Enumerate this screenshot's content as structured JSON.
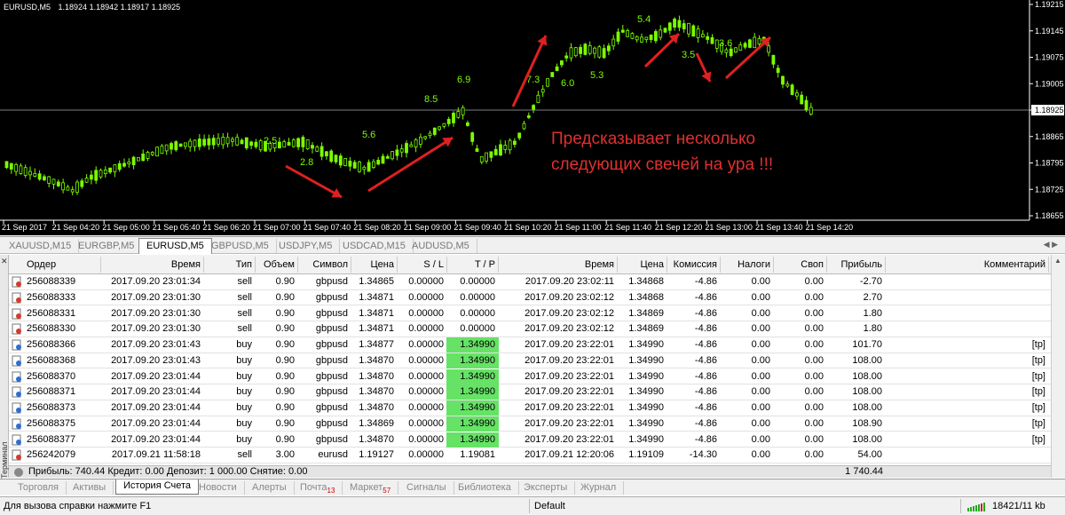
{
  "chart": {
    "symbol": "EURUSD,M5",
    "ohlc": "1.18924 1.18942 1.18917 1.18925",
    "price_levels": [
      "1.19215",
      "1.19145",
      "1.19075",
      "1.19005",
      "1.18925",
      "1.18865",
      "1.18795",
      "1.18725",
      "1.18655"
    ],
    "current_price": "1.18925",
    "time_labels": [
      "21 Sep 2017",
      "21 Sep 04:20",
      "21 Sep 05:00",
      "21 Sep 05:40",
      "21 Sep 06:20",
      "21 Sep 07:00",
      "21 Sep 07:40",
      "21 Sep 08:20",
      "21 Sep 09:00",
      "21 Sep 09:40",
      "21 Sep 10:20",
      "21 Sep 11:00",
      "21 Sep 11:40",
      "21 Sep 12:20",
      "21 Sep 13:00",
      "21 Sep 13:40",
      "21 Sep 14:20"
    ],
    "annotation": [
      "Предсказывает несколько",
      "следующих свечей на ура !!!"
    ],
    "chart_labels": [
      "2.5",
      "2.8",
      "5.6",
      "8.5",
      "6.9",
      "7.3",
      "6.0",
      "5.3",
      "5.4",
      "3.5",
      "3.6"
    ],
    "colors": {
      "background": "#000000",
      "candle": "#7CFC00",
      "grid": "#ffffff",
      "annotation": "#e03030",
      "arrow": "#e02020"
    }
  },
  "chart_tabs": [
    "XAUUSD,M15",
    "EURGBP,M5",
    "EURUSD,M5",
    "GBPUSD,M5",
    "USDJPY,M5",
    "USDCAD,M15",
    "AUDUSD,M5"
  ],
  "chart_tabs_active": "EURUSD,M5",
  "table": {
    "headers": {
      "order": "Ордер",
      "open_time": "Время",
      "type": "Тип",
      "volume": "Объем",
      "symbol": "Символ",
      "price": "Цена",
      "sl": "S / L",
      "tp": "T / P",
      "close_time": "Время",
      "close_price": "Цена",
      "commission": "Комиссия",
      "taxes": "Налоги",
      "swap": "Своп",
      "profit": "Прибыль",
      "comment": "Комментарий"
    },
    "rows": [
      {
        "order": "256088339",
        "open_time": "2017.09.20 23:01:34",
        "type": "sell",
        "volume": "0.90",
        "symbol": "gbpusd",
        "price": "1.34865",
        "sl": "0.00000",
        "tp": "0.00000",
        "close_time": "2017.09.20 23:02:11",
        "close_price": "1.34868",
        "commission": "-4.86",
        "taxes": "0.00",
        "swap": "0.00",
        "profit": "-2.70",
        "comment": "",
        "tp_hit": false
      },
      {
        "order": "256088333",
        "open_time": "2017.09.20 23:01:30",
        "type": "sell",
        "volume": "0.90",
        "symbol": "gbpusd",
        "price": "1.34871",
        "sl": "0.00000",
        "tp": "0.00000",
        "close_time": "2017.09.20 23:02:12",
        "close_price": "1.34868",
        "commission": "-4.86",
        "taxes": "0.00",
        "swap": "0.00",
        "profit": "2.70",
        "comment": "",
        "tp_hit": false
      },
      {
        "order": "256088331",
        "open_time": "2017.09.20 23:01:30",
        "type": "sell",
        "volume": "0.90",
        "symbol": "gbpusd",
        "price": "1.34871",
        "sl": "0.00000",
        "tp": "0.00000",
        "close_time": "2017.09.20 23:02:12",
        "close_price": "1.34869",
        "commission": "-4.86",
        "taxes": "0.00",
        "swap": "0.00",
        "profit": "1.80",
        "comment": "",
        "tp_hit": false
      },
      {
        "order": "256088330",
        "open_time": "2017.09.20 23:01:30",
        "type": "sell",
        "volume": "0.90",
        "symbol": "gbpusd",
        "price": "1.34871",
        "sl": "0.00000",
        "tp": "0.00000",
        "close_time": "2017.09.20 23:02:12",
        "close_price": "1.34869",
        "commission": "-4.86",
        "taxes": "0.00",
        "swap": "0.00",
        "profit": "1.80",
        "comment": "",
        "tp_hit": false
      },
      {
        "order": "256088366",
        "open_time": "2017.09.20 23:01:43",
        "type": "buy",
        "volume": "0.90",
        "symbol": "gbpusd",
        "price": "1.34877",
        "sl": "0.00000",
        "tp": "1.34990",
        "close_time": "2017.09.20 23:22:01",
        "close_price": "1.34990",
        "commission": "-4.86",
        "taxes": "0.00",
        "swap": "0.00",
        "profit": "101.70",
        "comment": "[tp]",
        "tp_hit": true
      },
      {
        "order": "256088368",
        "open_time": "2017.09.20 23:01:43",
        "type": "buy",
        "volume": "0.90",
        "symbol": "gbpusd",
        "price": "1.34870",
        "sl": "0.00000",
        "tp": "1.34990",
        "close_time": "2017.09.20 23:22:01",
        "close_price": "1.34990",
        "commission": "-4.86",
        "taxes": "0.00",
        "swap": "0.00",
        "profit": "108.00",
        "comment": "[tp]",
        "tp_hit": true
      },
      {
        "order": "256088370",
        "open_time": "2017.09.20 23:01:44",
        "type": "buy",
        "volume": "0.90",
        "symbol": "gbpusd",
        "price": "1.34870",
        "sl": "0.00000",
        "tp": "1.34990",
        "close_time": "2017.09.20 23:22:01",
        "close_price": "1.34990",
        "commission": "-4.86",
        "taxes": "0.00",
        "swap": "0.00",
        "profit": "108.00",
        "comment": "[tp]",
        "tp_hit": true
      },
      {
        "order": "256088371",
        "open_time": "2017.09.20 23:01:44",
        "type": "buy",
        "volume": "0.90",
        "symbol": "gbpusd",
        "price": "1.34870",
        "sl": "0.00000",
        "tp": "1.34990",
        "close_time": "2017.09.20 23:22:01",
        "close_price": "1.34990",
        "commission": "-4.86",
        "taxes": "0.00",
        "swap": "0.00",
        "profit": "108.00",
        "comment": "[tp]",
        "tp_hit": true
      },
      {
        "order": "256088373",
        "open_time": "2017.09.20 23:01:44",
        "type": "buy",
        "volume": "0.90",
        "symbol": "gbpusd",
        "price": "1.34870",
        "sl": "0.00000",
        "tp": "1.34990",
        "close_time": "2017.09.20 23:22:01",
        "close_price": "1.34990",
        "commission": "-4.86",
        "taxes": "0.00",
        "swap": "0.00",
        "profit": "108.00",
        "comment": "[tp]",
        "tp_hit": true
      },
      {
        "order": "256088375",
        "open_time": "2017.09.20 23:01:44",
        "type": "buy",
        "volume": "0.90",
        "symbol": "gbpusd",
        "price": "1.34869",
        "sl": "0.00000",
        "tp": "1.34990",
        "close_time": "2017.09.20 23:22:01",
        "close_price": "1.34990",
        "commission": "-4.86",
        "taxes": "0.00",
        "swap": "0.00",
        "profit": "108.90",
        "comment": "[tp]",
        "tp_hit": true
      },
      {
        "order": "256088377",
        "open_time": "2017.09.20 23:01:44",
        "type": "buy",
        "volume": "0.90",
        "symbol": "gbpusd",
        "price": "1.34870",
        "sl": "0.00000",
        "tp": "1.34990",
        "close_time": "2017.09.20 23:22:01",
        "close_price": "1.34990",
        "commission": "-4.86",
        "taxes": "0.00",
        "swap": "0.00",
        "profit": "108.00",
        "comment": "[tp]",
        "tp_hit": true
      },
      {
        "order": "256242079",
        "open_time": "2017.09.21 11:58:18",
        "type": "sell",
        "volume": "3.00",
        "symbol": "eurusd",
        "price": "1.19127",
        "sl": "0.00000",
        "tp": "1.19081",
        "close_time": "2017.09.21 12:20:06",
        "close_price": "1.19109",
        "commission": "-14.30",
        "taxes": "0.00",
        "swap": "0.00",
        "profit": "54.00",
        "comment": "",
        "tp_hit": false
      }
    ],
    "tp_highlight_color": "#66e266"
  },
  "summary": {
    "text": "Прибыль: 740.44  Кредит: 0.00  Депозит: 1 000.00  Снятие: 0.00",
    "total": "1 740.44"
  },
  "terminal_label": "Терминал",
  "bottom_tabs": [
    {
      "label": "Торговля",
      "badge": ""
    },
    {
      "label": "Активы",
      "badge": ""
    },
    {
      "label": "История Счета",
      "badge": ""
    },
    {
      "label": "Новости",
      "badge": ""
    },
    {
      "label": "Алерты",
      "badge": ""
    },
    {
      "label": "Почта",
      "badge": "13"
    },
    {
      "label": "Маркет",
      "badge": "57"
    },
    {
      "label": "Сигналы",
      "badge": ""
    },
    {
      "label": "Библиотека",
      "badge": ""
    },
    {
      "label": "Эксперты",
      "badge": ""
    },
    {
      "label": "Журнал",
      "badge": ""
    }
  ],
  "bottom_tabs_active": "История Счета",
  "status": {
    "help": "Для вызова справки нажмите F1",
    "profile": "Default",
    "traffic": "18421/11 kb"
  }
}
